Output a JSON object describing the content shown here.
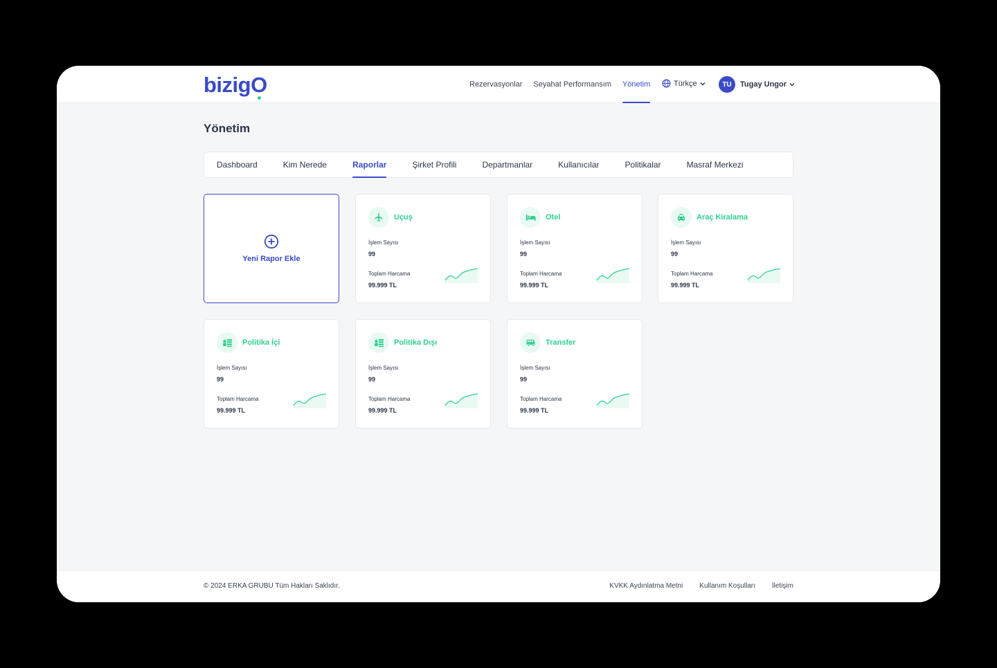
{
  "brand": {
    "logo_prefix": "bizig",
    "logo_last": "O"
  },
  "header": {
    "nav": [
      {
        "label": "Rezervasyonlar",
        "active": false
      },
      {
        "label": "Seyahat Performansım",
        "active": false
      },
      {
        "label": "Yönetim",
        "active": true
      }
    ],
    "language": "Türkçe",
    "user": {
      "initials": "TU",
      "name": "Tugay Ungor"
    }
  },
  "page": {
    "title": "Yönetim"
  },
  "tabs": [
    {
      "label": "Dashboard",
      "active": false
    },
    {
      "label": "Kim Nerede",
      "active": false
    },
    {
      "label": "Raporlar",
      "active": true
    },
    {
      "label": "Şirket Profili",
      "active": false
    },
    {
      "label": "Departmanlar",
      "active": false
    },
    {
      "label": "Kullanıcılar",
      "active": false
    },
    {
      "label": "Politikalar",
      "active": false
    },
    {
      "label": "Masraf Merkezi",
      "active": false
    }
  ],
  "add_card": {
    "label": "Yeni Rapor Ekle",
    "icon": "plus-circle-icon"
  },
  "reports": [
    {
      "title": "Uçuş",
      "icon": "plane-icon",
      "count_label": "İşlem Sayısı",
      "count": "99",
      "spend_label": "Toplam Harcama",
      "spend": "99.999 TL"
    },
    {
      "title": "Otel",
      "icon": "bed-icon",
      "count_label": "İşlem Sayısı",
      "count": "99",
      "spend_label": "Toplam Harcama",
      "spend": "99.999 TL"
    },
    {
      "title": "Araç Kiralama",
      "icon": "car-icon",
      "count_label": "İşlem Sayısı",
      "count": "99",
      "spend_label": "Toplam Harcama",
      "spend": "99.999 TL"
    },
    {
      "title": "Politika İçi",
      "icon": "money-stack-icon",
      "count_label": "İşlem Sayısı",
      "count": "99",
      "spend_label": "Toplam Harcama",
      "spend": "99.999 TL"
    },
    {
      "title": "Politika Dışı",
      "icon": "money-stack-icon",
      "count_label": "İşlem Sayısı",
      "count": "99",
      "spend_label": "Toplam Harcama",
      "spend": "99.999 TL"
    },
    {
      "title": "Transfer",
      "icon": "bus-icon",
      "count_label": "İşlem Sayısı",
      "count": "99",
      "spend_label": "Toplam Harcama",
      "spend": "99.999 TL"
    }
  ],
  "footer": {
    "copyright": "© 2024 ERKA GRUBU Tüm Hakları Saklıdır.",
    "links": [
      "KVKK Aydınlatma Metni",
      "Kullanım Koşulları",
      "İletişim"
    ]
  },
  "colors": {
    "primary": "#3a4bc6",
    "accent": "#2fd08e",
    "background": "#f5f6f8"
  }
}
